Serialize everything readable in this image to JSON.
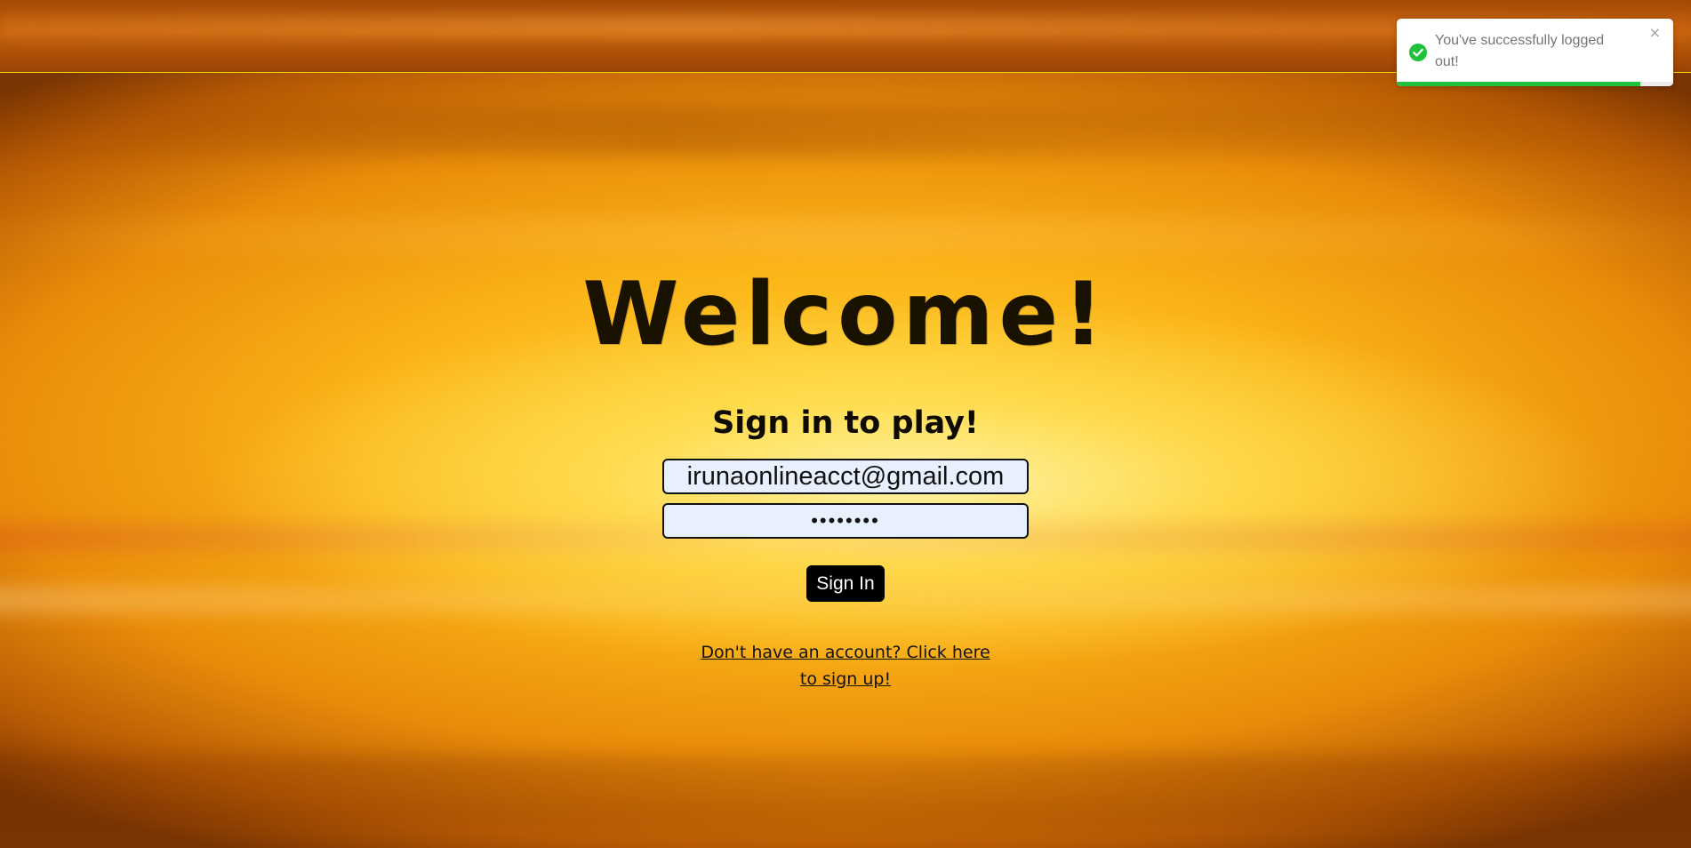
{
  "title": "Welcome!",
  "subtitle": "Sign in to play!",
  "form": {
    "email_value": "irunaonlineacct@gmail.com",
    "password_value": "••••••••",
    "signin_label": "Sign In",
    "signup_link": "Don't have an account? Click here to sign up!"
  },
  "toast": {
    "message": "You've successfully logged out!",
    "close_symbol": "×",
    "icon": "check-circle-icon",
    "progress_remaining": 0.88,
    "status_color": "#1fc23a"
  },
  "colors": {
    "topbar_border": "#e8d60c",
    "button_bg": "#000000",
    "input_bg": "#e8f0fe"
  }
}
